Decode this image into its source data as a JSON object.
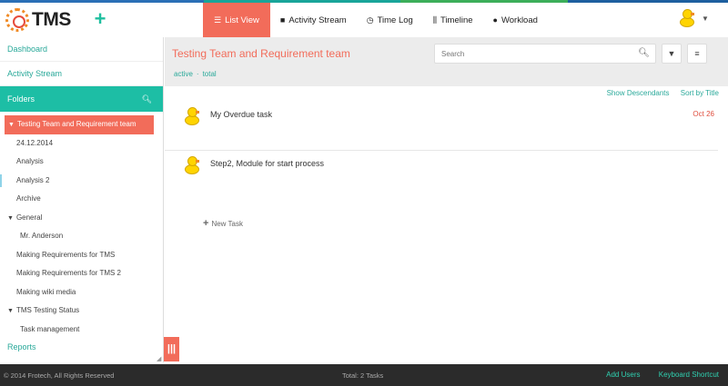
{
  "app": {
    "logo_text": "TMS"
  },
  "nav": {
    "items": [
      {
        "label": "List View",
        "icon": "list-icon"
      },
      {
        "label": "Activity Stream",
        "icon": "comment-icon"
      },
      {
        "label": "Time Log",
        "icon": "clock-icon"
      },
      {
        "label": "Timeline",
        "icon": "timeline-icon"
      },
      {
        "label": "Workload",
        "icon": "user-icon"
      }
    ],
    "active": "List View"
  },
  "sidebar": {
    "dashboard": "Dashboard",
    "activity_stream": "Activity Stream",
    "folders": "Folders",
    "tree": [
      "Testing Team and Requirement team",
      "24.12.2014",
      "Analysis",
      "Analysis 2",
      "Archive",
      "General",
      "Mr. Anderson",
      "Making Requirements for TMS",
      "Making Requirements for TMS 2",
      "Making wiki media",
      "TMS Testing Status",
      "Task management"
    ],
    "reports": "Reports"
  },
  "main": {
    "folder_title": "Testing Team and Requirement team",
    "filter_active": "active",
    "filter_total": "total",
    "search_placeholder": "Search",
    "show_descendants": "Show Descendants",
    "sort_by": "Sort by Title",
    "tasks": [
      {
        "title": "My Overdue task",
        "date": "Oct 26"
      },
      {
        "title": "Step2, Module for start process",
        "date": ""
      }
    ],
    "new_task": "New Task"
  },
  "footer": {
    "copyright": "© 2014 Frotech, All Rights Reserved",
    "total": "Total: 2 Tasks",
    "add_users": "Add Users",
    "shortcut": "Keyboard Shortcut"
  },
  "colors": {
    "accent": "#f26c5a",
    "teal": "#1dbea5",
    "link": "#2aa99a"
  }
}
